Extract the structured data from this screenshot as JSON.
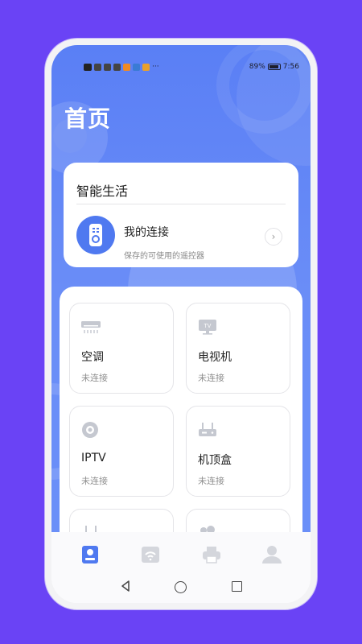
{
  "status_bar": {
    "battery_text": "89%",
    "time": "7:56"
  },
  "page_title": "首页",
  "smart_life": {
    "title": "智能生活",
    "my_connection": {
      "title": "我的连接",
      "subtitle": "保存的可使用的遥控器",
      "icon": "remote-control-icon"
    }
  },
  "devices": [
    {
      "name": "空调",
      "status": "未连接",
      "icon": "air-conditioner-icon"
    },
    {
      "name": "电视机",
      "status": "未连接",
      "icon": "tv-icon"
    },
    {
      "name": "IPTV",
      "status": "未连接",
      "icon": "iptv-disc-icon"
    },
    {
      "name": "机顶盒",
      "status": "未连接",
      "icon": "set-top-box-icon"
    },
    {
      "name": "",
      "status": "",
      "icon": "fan-icon"
    },
    {
      "name": "",
      "status": "",
      "icon": "camera-icon"
    }
  ],
  "tabs": [
    {
      "icon": "home-remote-icon",
      "active": true
    },
    {
      "icon": "wifi-screen-icon",
      "active": false
    },
    {
      "icon": "printer-icon",
      "active": false
    },
    {
      "icon": "user-icon",
      "active": false
    }
  ],
  "colors": {
    "background": "#6a43f5",
    "accent": "#4f79f0",
    "hero_gradient_top": "#5a7ff5"
  }
}
